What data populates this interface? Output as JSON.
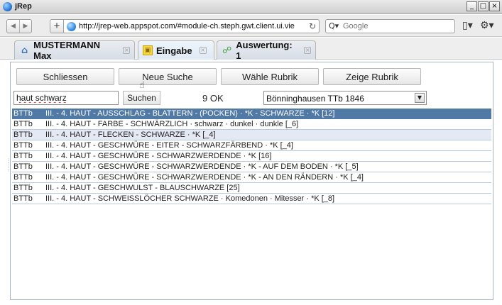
{
  "window": {
    "title": "jRep",
    "minimize": "_",
    "maximize": "□",
    "close": "×"
  },
  "nav": {
    "back": "◀",
    "forward": "▶",
    "add_tab": "+",
    "url": "http://jrep-web.appspot.com/#module-ch.steph.gwt.client.ui.vie",
    "reload": "↻",
    "search_placeholder": "Google",
    "search_icon": "Q▾",
    "page_menu": "▯▾",
    "tools_menu": "⚙▾"
  },
  "tabs": [
    {
      "label": "MUSTERMANN Max",
      "icon": "home-icon",
      "glyph": "⌂",
      "close": "×"
    },
    {
      "label": "Eingabe",
      "icon": "input-icon",
      "glyph": "▣",
      "close": "×"
    },
    {
      "label": "Auswertung: 1",
      "icon": "network-icon",
      "glyph": "☍",
      "close": "×"
    }
  ],
  "actions": {
    "close": "Schliessen",
    "new_search": "Neue Suche",
    "choose_rubric": "Wähle Rubrik",
    "show_rubric": "Zeige Rubrik"
  },
  "search": {
    "query": "haut schwarz",
    "button": "Suchen",
    "status": "9 OK",
    "rubric_selected": "Bönninghausen TTb 1846",
    "rubric_arrow": "▼"
  },
  "results": [
    {
      "code": "BTTb",
      "text": "III. - 4. HAUT - AUSSCHLAG - BLATTERN - (POCKEN) · *K - SCHWARZE · *K [12]"
    },
    {
      "code": "BTTb",
      "text": "III. - 4. HAUT - FARBE - SCHWÄRZLICH · schwarz · dunkel · dunkle [_6]"
    },
    {
      "code": "BTTb",
      "text": "III. - 4. HAUT - FLECKEN - SCHWARZE · *K [_4]"
    },
    {
      "code": "BTTb",
      "text": "III. - 4. HAUT - GESCHWÜRE - EITER - SCHWARZFÄRBEND · *K [_4]"
    },
    {
      "code": "BTTb",
      "text": "III. - 4. HAUT - GESCHWÜRE - SCHWARZWERDENDE · *K [16]"
    },
    {
      "code": "BTTb",
      "text": "III. - 4. HAUT - GESCHWÜRE - SCHWARZWERDENDE · *K - AUF DEM BODEN · *K [_5]"
    },
    {
      "code": "BTTb",
      "text": "III. - 4. HAUT - GESCHWÜRE - SCHWARZWERDENDE · *K - AN DEN RÄNDERN · *K [_4]"
    },
    {
      "code": "BTTb",
      "text": "III. - 4. HAUT - GESCHWULST - BLAUSCHWARZE [25]"
    },
    {
      "code": "BTTb",
      "text": "III. - 4. HAUT - SCHWEISSLÖCHER SCHWARZE · Komedonen · Mitesser · *K [_8]"
    }
  ],
  "state": {
    "selected_row": 0,
    "hover_row": 2
  },
  "colors": {
    "selection": "#5179a6",
    "hover": "#e5e9f4",
    "row_divider": "#b7c9dd"
  }
}
